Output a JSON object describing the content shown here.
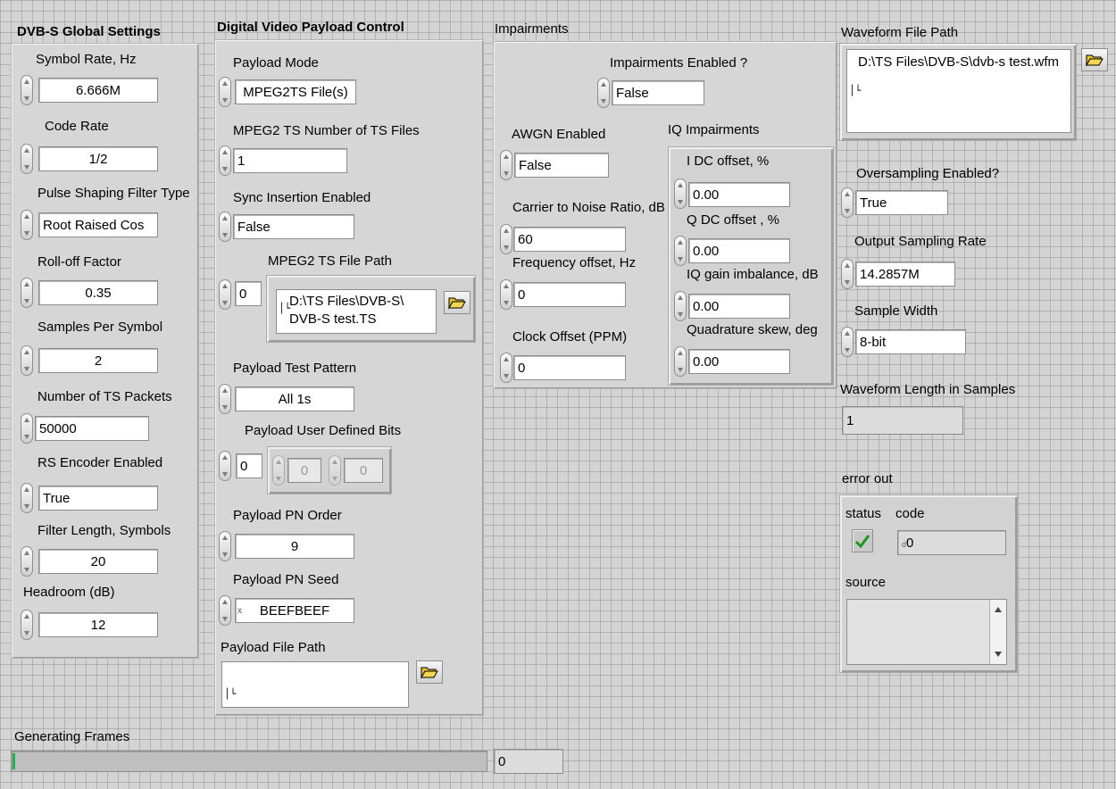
{
  "global": {
    "title": "DVB-S Global Settings",
    "symbol_rate": {
      "label": "Symbol Rate, Hz",
      "value": "6.666M"
    },
    "code_rate": {
      "label": "Code Rate",
      "value": "1/2"
    },
    "pulse_filter": {
      "label": "Pulse Shaping Filter Type",
      "value": "Root Raised Cos"
    },
    "rolloff": {
      "label": "Roll-off Factor",
      "value": "0.35"
    },
    "sps": {
      "label": "Samples Per Symbol",
      "value": "2"
    },
    "ts_packets": {
      "label": "Number of TS Packets",
      "value": "50000"
    },
    "rs_encoder": {
      "label": "RS Encoder Enabled",
      "value": "True"
    },
    "filter_length": {
      "label": "Filter Length, Symbols",
      "value": "20"
    },
    "headroom": {
      "label": "Headroom (dB)",
      "value": "12"
    }
  },
  "payload": {
    "title": "Digital Video Payload Control",
    "mode": {
      "label": "Payload Mode",
      "value": "MPEG2TS File(s)"
    },
    "num_ts_files": {
      "label": "MPEG2 TS Number of TS Files",
      "value": "1"
    },
    "sync_insertion": {
      "label": "Sync Insertion Enabled",
      "value": "False"
    },
    "ts_file_path": {
      "label": "MPEG2 TS File Path",
      "index": "0",
      "value_line1": "D:\\TS Files\\DVB-S\\",
      "value_line2": "DVB-S test.TS"
    },
    "test_pattern": {
      "label": "Payload Test Pattern",
      "value": "All 1s"
    },
    "user_bits": {
      "label": "Payload User Defined Bits",
      "index": "0",
      "bit0": "0",
      "bit1": "0"
    },
    "pn_order": {
      "label": "Payload PN Order",
      "value": "9"
    },
    "pn_seed": {
      "label": "Payload PN Seed",
      "prefix": "x",
      "value": "BEEFBEEF"
    },
    "file_path": {
      "label": "Payload File Path",
      "value": ""
    }
  },
  "impairments": {
    "title": "Impairments",
    "enabled": {
      "label": "Impairments Enabled ?",
      "value": "False"
    },
    "awgn": {
      "label": "AWGN Enabled",
      "value": "False"
    },
    "cnr": {
      "label": "Carrier to Noise Ratio, dB",
      "value": "60"
    },
    "freq_offset": {
      "label": "Frequency offset, Hz",
      "value": "0"
    },
    "clock_offset": {
      "label": "Clock Offset (PPM)",
      "value": "0"
    },
    "iq": {
      "title": "IQ Impairments",
      "i_dc": {
        "label": "I DC offset, %",
        "value": "0.00"
      },
      "q_dc": {
        "label": "Q DC offset , %",
        "value": "0.00"
      },
      "gain_imb": {
        "label": "IQ gain imbalance, dB",
        "value": "0.00"
      },
      "quad_skew": {
        "label": "Quadrature skew, deg",
        "value": "0.00"
      }
    }
  },
  "output": {
    "waveform_path": {
      "label": "Waveform File Path",
      "value": "D:\\TS Files\\DVB-S\\dvb-s test.wfm"
    },
    "oversampling": {
      "label": "Oversampling Enabled?",
      "value": "True"
    },
    "sampling_rate": {
      "label": "Output Sampling Rate",
      "value": "14.2857M"
    },
    "sample_width": {
      "label": "Sample Width",
      "value": "8-bit"
    },
    "waveform_length": {
      "label": "Waveform Length in Samples",
      "value": "1"
    },
    "error_out": {
      "title": "error out",
      "status_label": "status",
      "code_label": "code",
      "code_prefix": "d",
      "code_value": "0",
      "source_label": "source",
      "source_value": ""
    }
  },
  "progress": {
    "label": "Generating Frames",
    "fraction": 0.003,
    "value": "0"
  },
  "colors": {
    "status_ok": "#1a9a1a",
    "progress_fill": "#22b14c"
  },
  "icons": {
    "spinner": "increment-decrement-arrows",
    "browse": "folder-open-icon",
    "path": "path-glyph"
  }
}
